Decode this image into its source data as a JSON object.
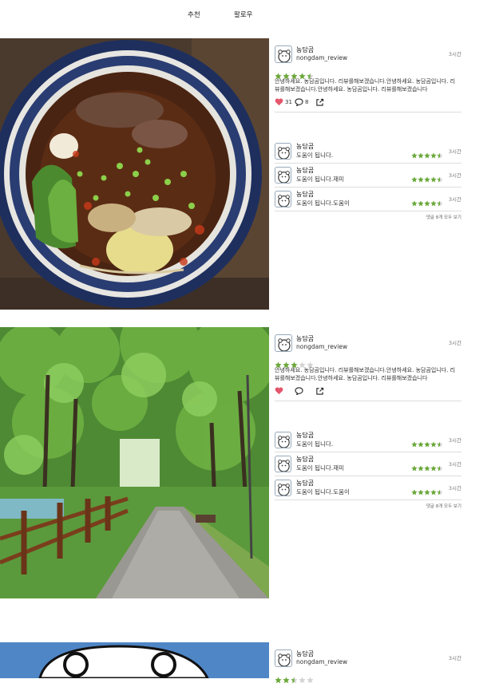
{
  "tabs": [
    "추천",
    "팔로우"
  ],
  "colors": {
    "star_on": "#6aa839",
    "star_off": "#d3d3d3",
    "heart": "#e4566b",
    "divider": "#dddddd"
  },
  "posts": [
    {
      "image": "beef-noodle-soup-photo",
      "user": "농담곰",
      "handle": "nongdam_review",
      "time": "3시간",
      "rating": 4.5,
      "text": "안녕하세요. 농담곰입니다. 리뷰를해보겠습니다.안녕하세요. 농담곰입니다. 리뷰를해보겠습니다.안녕하세요. 농담곰입니다. 리뷰를해보겠습니다",
      "likes": "31",
      "comments_count": "8",
      "liked": true,
      "comments": [
        {
          "user": "농담곰",
          "text": "도움이 됩니다.",
          "rating": 4.5,
          "time": "3시간"
        },
        {
          "user": "농담곰",
          "text": "도움이 됩니다.재미",
          "rating": 4.5,
          "time": "3시간"
        },
        {
          "user": "농담곰",
          "text": "도움이 됩니다.도움이",
          "rating": 4.5,
          "time": "3시간"
        }
      ],
      "see_all": "댓글 8개 모두 보기"
    },
    {
      "image": "park-path-photo",
      "user": "농담곰",
      "handle": "nongdam_review",
      "time": "3시간",
      "rating": 3,
      "text": "안녕하세요. 농담곰입니다. 리뷰를해보겠습니다.안녕하세요. 농담곰입니다. 리뷰를해보겠습니다.안녕하세요. 농담곰입니다. 리뷰를해보겠습니다",
      "likes": "",
      "comments_count": "",
      "liked": true,
      "comments": [
        {
          "user": "농담곰",
          "text": "도움이 됩니다.",
          "rating": 4.5,
          "time": "3시간"
        },
        {
          "user": "농담곰",
          "text": "도움이 됩니다.재미",
          "rating": 4.5,
          "time": "3시간"
        },
        {
          "user": "농담곰",
          "text": "도움이 됩니다.도움이",
          "rating": 4.5,
          "time": "3시간"
        }
      ],
      "see_all": "댓글 8개 모두 보기"
    },
    {
      "image": "bear-illustration-photo",
      "user": "농담곰",
      "handle": "nongdam_review",
      "time": "3시간",
      "rating": 2.5
    }
  ]
}
